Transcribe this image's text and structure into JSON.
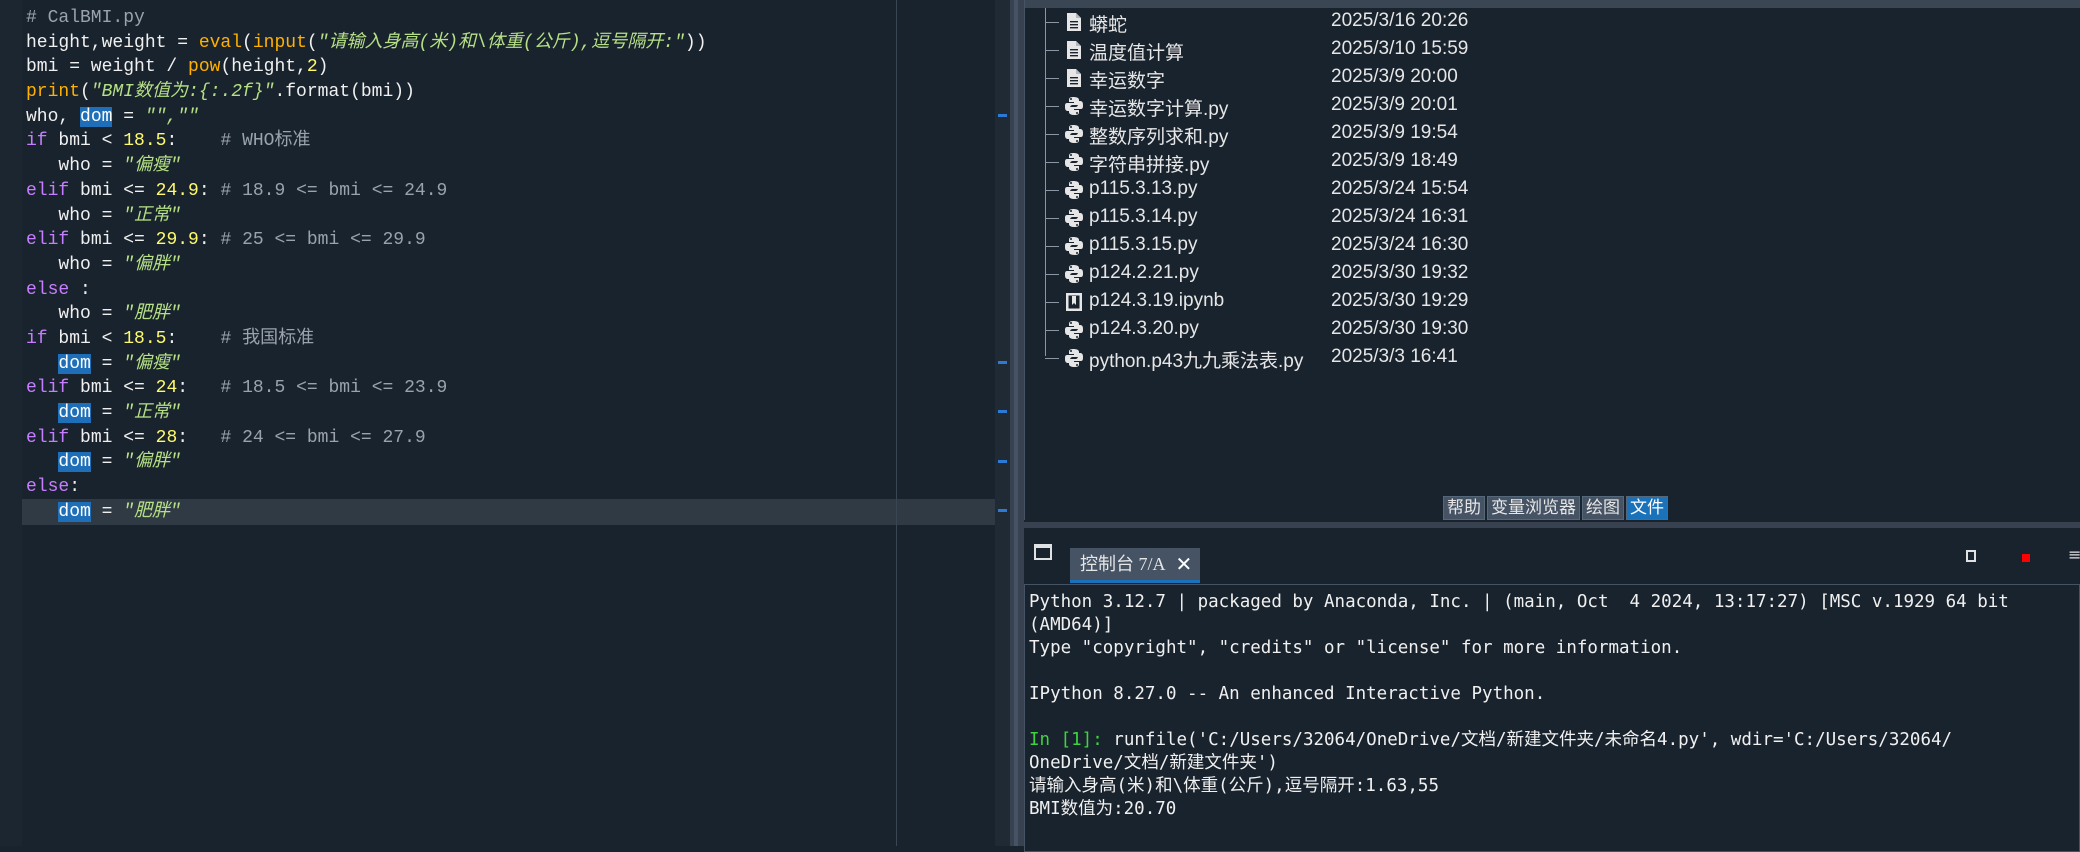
{
  "editor": {
    "lines": [
      [
        {
          "t": "# CalBMI.py",
          "c": "com"
        }
      ],
      [
        {
          "t": "height,weight = ",
          "c": "txt"
        },
        {
          "t": "eval",
          "c": "fn"
        },
        {
          "t": "(",
          "c": "txt"
        },
        {
          "t": "input",
          "c": "fn"
        },
        {
          "t": "(",
          "c": "txt"
        },
        {
          "t": "\"请输入身高(米)和\\体重(公斤),逗号隔开:\"",
          "c": "str"
        },
        {
          "t": "))",
          "c": "txt"
        }
      ],
      [
        {
          "t": "bmi = weight / ",
          "c": "txt"
        },
        {
          "t": "pow",
          "c": "fn"
        },
        {
          "t": "(height,",
          "c": "txt"
        },
        {
          "t": "2",
          "c": "num"
        },
        {
          "t": ")",
          "c": "txt"
        }
      ],
      [
        {
          "t": "print",
          "c": "fn"
        },
        {
          "t": "(",
          "c": "txt"
        },
        {
          "t": "\"BMI数值为:{:.2f}\"",
          "c": "str"
        },
        {
          "t": ".format(bmi))",
          "c": "txt"
        }
      ],
      [
        {
          "t": "who, ",
          "c": "txt"
        },
        {
          "t": "dom",
          "c": "hl"
        },
        {
          "t": " = ",
          "c": "txt"
        },
        {
          "t": "\"\",\"\"",
          "c": "str"
        }
      ],
      [
        {
          "t": "if",
          "c": "kw"
        },
        {
          "t": " bmi < ",
          "c": "txt"
        },
        {
          "t": "18.5",
          "c": "num"
        },
        {
          "t": ":    ",
          "c": "txt"
        },
        {
          "t": "# WHO标准",
          "c": "com"
        }
      ],
      [
        {
          "t": "   who = ",
          "c": "txt"
        },
        {
          "t": "\"偏瘦\"",
          "c": "str"
        }
      ],
      [
        {
          "t": "elif",
          "c": "kw"
        },
        {
          "t": " bmi <= ",
          "c": "txt"
        },
        {
          "t": "24.9",
          "c": "num"
        },
        {
          "t": ": ",
          "c": "txt"
        },
        {
          "t": "# 18.9 <= bmi <= 24.9",
          "c": "com"
        }
      ],
      [
        {
          "t": "   who = ",
          "c": "txt"
        },
        {
          "t": "\"正常\"",
          "c": "str"
        }
      ],
      [
        {
          "t": "elif",
          "c": "kw"
        },
        {
          "t": " bmi <= ",
          "c": "txt"
        },
        {
          "t": "29.9",
          "c": "num"
        },
        {
          "t": ": ",
          "c": "txt"
        },
        {
          "t": "# 25 <= bmi <= 29.9",
          "c": "com"
        }
      ],
      [
        {
          "t": "   who = ",
          "c": "txt"
        },
        {
          "t": "\"偏胖\"",
          "c": "str"
        }
      ],
      [
        {
          "t": "else",
          "c": "kw"
        },
        {
          "t": " :",
          "c": "txt"
        }
      ],
      [
        {
          "t": "   who = ",
          "c": "txt"
        },
        {
          "t": "\"肥胖\"",
          "c": "str"
        }
      ],
      [
        {
          "t": "if",
          "c": "kw"
        },
        {
          "t": " bmi < ",
          "c": "txt"
        },
        {
          "t": "18.5",
          "c": "num"
        },
        {
          "t": ":    ",
          "c": "txt"
        },
        {
          "t": "# 我国标准",
          "c": "com"
        }
      ],
      [
        {
          "t": "   ",
          "c": "txt"
        },
        {
          "t": "dom",
          "c": "hl"
        },
        {
          "t": " = ",
          "c": "txt"
        },
        {
          "t": "\"偏瘦\"",
          "c": "str"
        }
      ],
      [
        {
          "t": "elif",
          "c": "kw"
        },
        {
          "t": " bmi <= ",
          "c": "txt"
        },
        {
          "t": "24",
          "c": "num"
        },
        {
          "t": ":   ",
          "c": "txt"
        },
        {
          "t": "# 18.5 <= bmi <= 23.9",
          "c": "com"
        }
      ],
      [
        {
          "t": "   ",
          "c": "txt"
        },
        {
          "t": "dom",
          "c": "hl"
        },
        {
          "t": " = ",
          "c": "txt"
        },
        {
          "t": "\"正常\"",
          "c": "str"
        }
      ],
      [
        {
          "t": "elif",
          "c": "kw"
        },
        {
          "t": " bmi <= ",
          "c": "txt"
        },
        {
          "t": "28",
          "c": "num"
        },
        {
          "t": ":   ",
          "c": "txt"
        },
        {
          "t": "# 24 <= bmi <= 27.9",
          "c": "com"
        }
      ],
      [
        {
          "t": "   ",
          "c": "txt"
        },
        {
          "t": "dom",
          "c": "hl"
        },
        {
          "t": " = ",
          "c": "txt"
        },
        {
          "t": "\"偏胖\"",
          "c": "str"
        }
      ],
      [
        {
          "t": "else",
          "c": "kw"
        },
        {
          "t": ":",
          "c": "txt"
        }
      ],
      [
        {
          "t": "   ",
          "c": "txt"
        },
        {
          "t": "dom",
          "c": "hl"
        },
        {
          "t": " = ",
          "c": "txt"
        },
        {
          "t": "\"肥胖\"",
          "c": "str"
        }
      ]
    ]
  },
  "files": {
    "items": [
      {
        "name": "蟒蛇",
        "date": "2025/3/16 20:26",
        "icon": "file-icon"
      },
      {
        "name": "温度值计算",
        "date": "2025/3/10 15:59",
        "icon": "file-icon"
      },
      {
        "name": "幸运数字",
        "date": "2025/3/9 20:00",
        "icon": "file-icon"
      },
      {
        "name": "幸运数字计算.py",
        "date": "2025/3/9 20:01",
        "icon": "python-file-icon"
      },
      {
        "name": "整数序列求和.py",
        "date": "2025/3/9 19:54",
        "icon": "python-file-icon"
      },
      {
        "name": "字符串拼接.py",
        "date": "2025/3/9 18:49",
        "icon": "python-file-icon"
      },
      {
        "name": "p115.3.13.py",
        "date": "2025/3/24 15:54",
        "icon": "python-file-icon"
      },
      {
        "name": "p115.3.14.py",
        "date": "2025/3/24 16:31",
        "icon": "python-file-icon"
      },
      {
        "name": "p115.3.15.py",
        "date": "2025/3/24 16:30",
        "icon": "python-file-icon"
      },
      {
        "name": "p124.2.21.py",
        "date": "2025/3/30 19:32",
        "icon": "python-file-icon"
      },
      {
        "name": "p124.3.19.ipynb",
        "date": "2025/3/30 19:29",
        "icon": "notebook-file-icon"
      },
      {
        "name": "p124.3.20.py",
        "date": "2025/3/30 19:30",
        "icon": "python-file-icon"
      },
      {
        "name": "python.p43九九乘法表.py",
        "date": "2025/3/3 16:41",
        "icon": "python-file-icon"
      }
    ],
    "tabs": [
      {
        "label": "帮助",
        "active": false
      },
      {
        "label": "变量浏览器",
        "active": false
      },
      {
        "label": "绘图",
        "active": false
      },
      {
        "label": "文件",
        "active": true
      }
    ]
  },
  "console": {
    "tab_label": "控制台 7/A",
    "close_glyph": "✕",
    "lines": [
      [
        {
          "t": "Python 3.12.7 | packaged by Anaconda, Inc. | (main, Oct  4 2024, 13:17:27) [MSC v.1929 64 bit",
          "c": "txt"
        }
      ],
      [
        {
          "t": "(AMD64)]",
          "c": "txt"
        }
      ],
      [
        {
          "t": "Type \"copyright\", \"credits\" or \"license\" for more information.",
          "c": "txt"
        }
      ],
      [
        {
          "t": "",
          "c": "txt"
        }
      ],
      [
        {
          "t": "IPython 8.27.0 -- An enhanced Interactive Python.",
          "c": "txt"
        }
      ],
      [
        {
          "t": "",
          "c": "txt"
        }
      ],
      [
        {
          "t": "In [1]: ",
          "c": "prompt"
        },
        {
          "t": "runfile('C:/Users/32064/OneDrive/文档/新建文件夹/未命名4.py', wdir='C:/Users/32064/",
          "c": "txt"
        }
      ],
      [
        {
          "t": "OneDrive/文档/新建文件夹')",
          "c": "txt"
        }
      ],
      [
        {
          "t": "请输入身高(米)和\\体重(公斤),逗号隔开:1.63,55",
          "c": "txt"
        }
      ],
      [
        {
          "t": "BMI数值为:20.70",
          "c": "txt"
        }
      ]
    ]
  },
  "colors": {
    "background": "#19232d",
    "accent": "#1a72bb",
    "keyword": "#c77dff",
    "builtin": "#ffb000",
    "number": "#fffa6b",
    "string": "#b5e085",
    "comment": "#9aa3ad",
    "prompt": "#3fd33f"
  }
}
